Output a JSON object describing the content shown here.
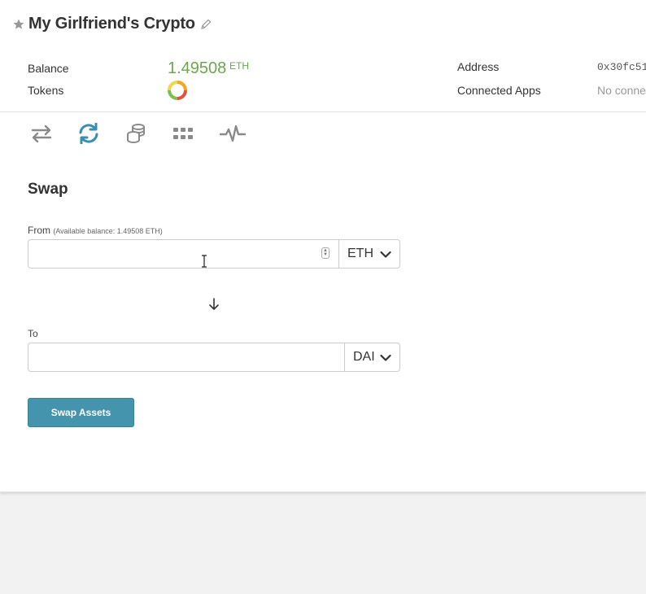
{
  "wallet": {
    "title": "My Girlfriend's Crypto",
    "icons": {
      "favorite": "star-icon",
      "edit": "pencil-icon"
    }
  },
  "info": {
    "balance_label": "Balance",
    "balance_value": "1.49508",
    "balance_unit": "ETH",
    "tokens_label": "Tokens",
    "address_label": "Address",
    "address_value": "0x30fc51",
    "connected_apps_label": "Connected Apps",
    "connected_apps_value": "No conne",
    "balance_color": "#6aa84f"
  },
  "tabs": [
    {
      "icon": "transfer-arrows-icon",
      "active": false
    },
    {
      "icon": "swap-refresh-icon",
      "active": true
    },
    {
      "icon": "coin-stack-icon",
      "active": false
    },
    {
      "icon": "grid-apps-icon",
      "active": false
    },
    {
      "icon": "activity-pulse-icon",
      "active": false
    }
  ],
  "swap": {
    "title": "Swap",
    "from_label": "From",
    "from_hint": "(Available balance: 1.49508 ETH)",
    "from_value": "",
    "from_token": "ETH",
    "to_label": "To",
    "to_value": "",
    "to_token": "DAI",
    "button_label": "Swap Assets"
  },
  "colors": {
    "accent": "#4594ae",
    "active_tab": "#3a8fb0",
    "inactive_tab": "#8a8a8a",
    "page_background": "#f2f2f2"
  }
}
